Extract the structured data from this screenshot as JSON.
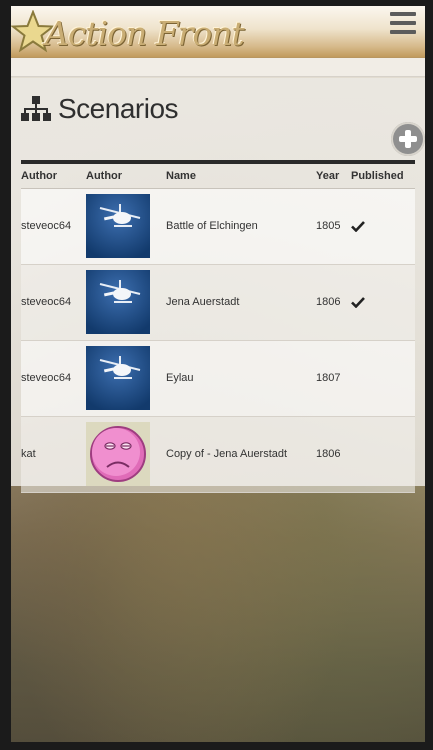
{
  "app": {
    "logo_text": "Action Front"
  },
  "page": {
    "title": "Scenarios"
  },
  "table": {
    "headers": {
      "author": "Author",
      "avatar": "Author",
      "name": "Name",
      "year": "Year",
      "published": "Published"
    },
    "rows": [
      {
        "author": "steveoc64",
        "avatar": "helicopter-avatar",
        "name": "Battle of Elchingen",
        "year": "1805",
        "published": true
      },
      {
        "author": "steveoc64",
        "avatar": "helicopter-avatar",
        "name": "Jena Auerstadt",
        "year": "1806",
        "published": true
      },
      {
        "author": "steveoc64",
        "avatar": "helicopter-avatar",
        "name": "Eylau",
        "year": "1807",
        "published": false
      },
      {
        "author": "kat",
        "avatar": "sad-face-avatar",
        "name": "Copy of - Jena Auerstadt",
        "year": "1806",
        "published": false
      }
    ]
  },
  "icons": {
    "menu": "hamburger-menu-icon",
    "heading": "sitemap-icon",
    "add": "plus-circle-icon",
    "published": "check-icon"
  },
  "colors": {
    "topbar": "#efe3cc",
    "logo": "#c9ad74",
    "add_button": "#8f8f8f",
    "avatar_blue": "#1f4a86"
  }
}
